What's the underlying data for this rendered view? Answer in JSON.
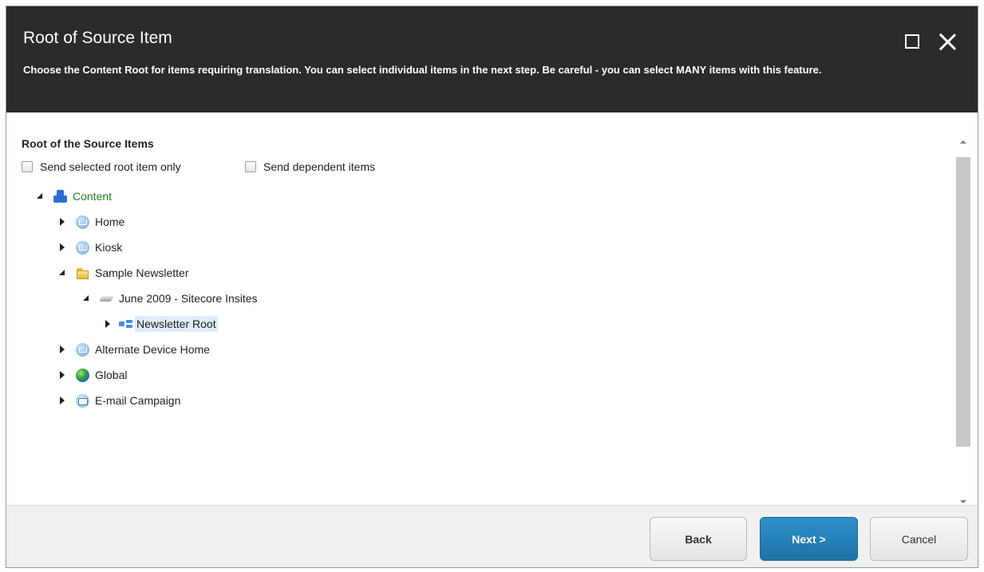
{
  "header": {
    "title": "Root of Source Item",
    "description": "Choose the Content Root for items requiring translation. You can select individual items in the next step. Be careful - you can select MANY items with this feature."
  },
  "section": {
    "title": "Root of the Source Items",
    "options": [
      {
        "label": "Send selected root item only",
        "checked": false
      },
      {
        "label": "Send dependent items",
        "checked": false
      }
    ]
  },
  "tree": [
    {
      "label": "Content",
      "icon": "content-tree-icon",
      "expanded": true,
      "level": 0,
      "color": "#238123"
    },
    {
      "label": "Home",
      "icon": "home-icon",
      "expanded": false,
      "level": 1
    },
    {
      "label": "Kiosk",
      "icon": "home-icon",
      "expanded": false,
      "level": 1
    },
    {
      "label": "Sample Newsletter",
      "icon": "folder-icon",
      "expanded": true,
      "level": 1
    },
    {
      "label": "June 2009 - Sitecore Insites",
      "icon": "newsletter-issue-icon",
      "expanded": true,
      "level": 2
    },
    {
      "label": "Newsletter Root",
      "icon": "newsletter-root-icon",
      "expanded": false,
      "level": 3,
      "selected": true
    },
    {
      "label": "Alternate Device Home",
      "icon": "home-icon",
      "expanded": false,
      "level": 1
    },
    {
      "label": "Global",
      "icon": "globe-icon",
      "expanded": false,
      "level": 1
    },
    {
      "label": "E-mail Campaign",
      "icon": "email-campaign-icon",
      "expanded": false,
      "level": 1
    }
  ],
  "footer": {
    "back_label": "Back",
    "next_label": "Next >",
    "cancel_label": "Cancel"
  },
  "colors": {
    "header_bg": "#2b2b2b",
    "primary_button": "#2880b9",
    "selection": "#ddecf8"
  }
}
